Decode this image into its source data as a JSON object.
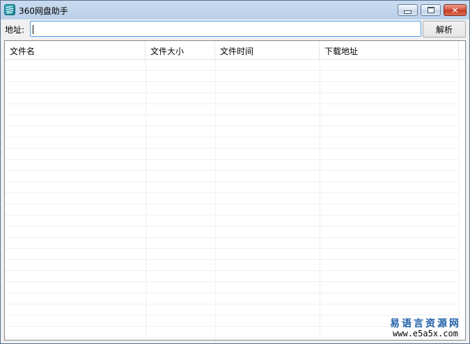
{
  "window": {
    "title": "360网盘助手",
    "icon": "app-icon",
    "controls": [
      "minimize",
      "maximize",
      "close"
    ]
  },
  "address_bar": {
    "label": "地址:",
    "value": "",
    "placeholder": "",
    "parse_button": "解析"
  },
  "file_list": {
    "columns": [
      "文件名",
      "文件大小",
      "文件时间",
      "下载地址"
    ],
    "rows": []
  },
  "watermark": {
    "text": "易语言资源网",
    "url": "www.e5a5x.com"
  },
  "colors": {
    "window_frame": "#b9cfe8",
    "input_focus_border": "#569de5",
    "close_button": "#c43a22",
    "watermark_text": "#1f5fa8"
  }
}
